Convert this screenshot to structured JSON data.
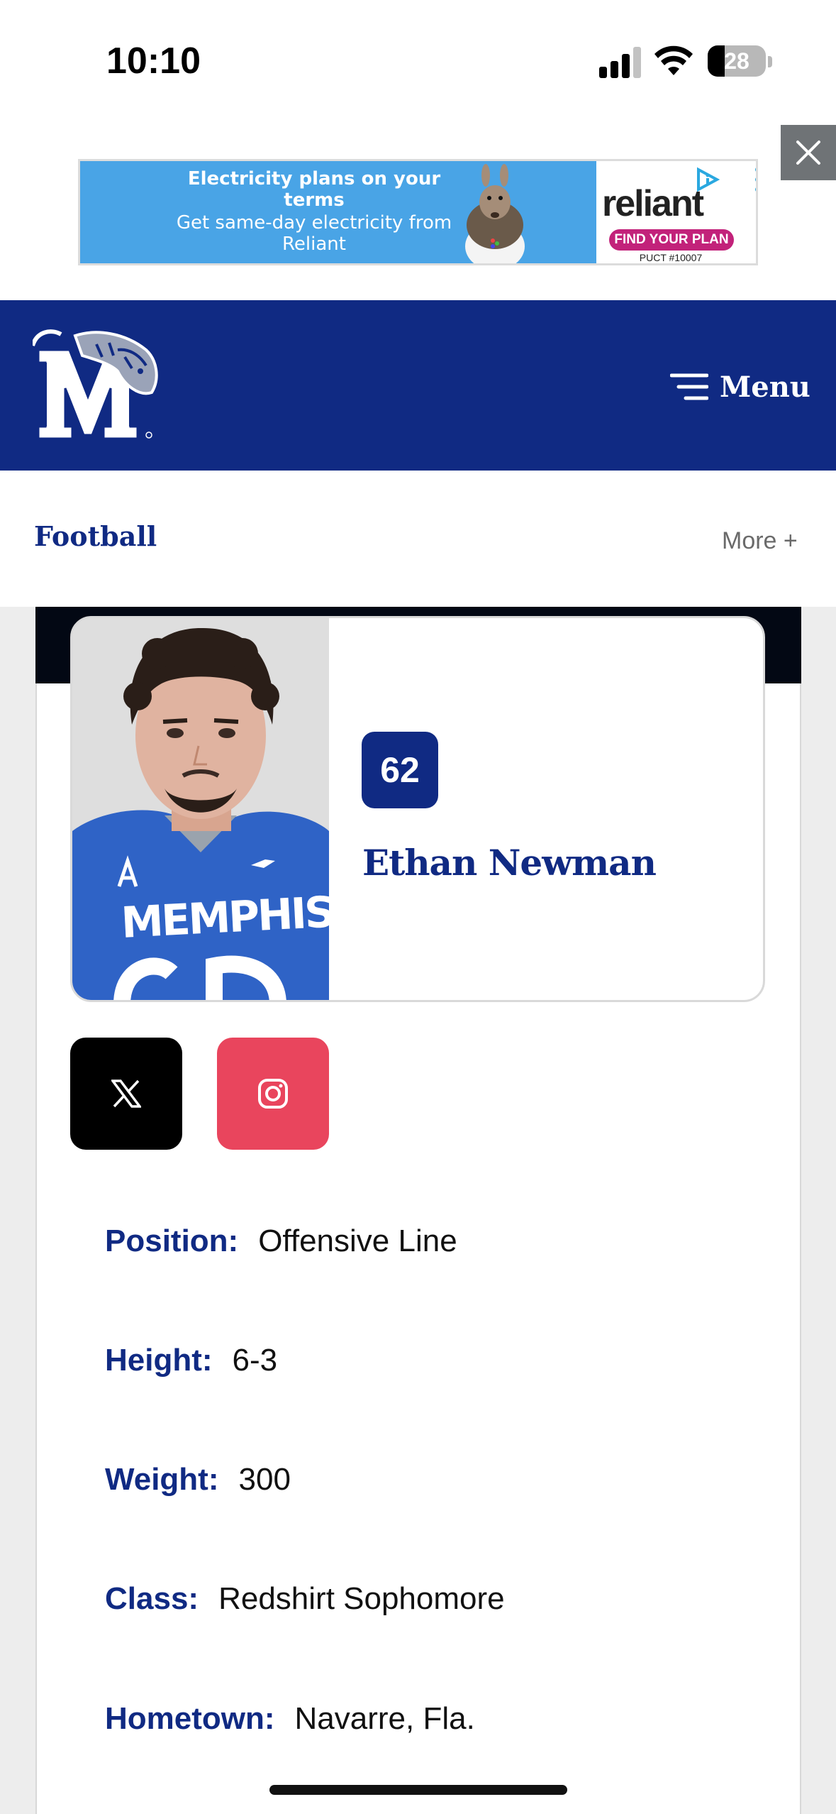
{
  "status_bar": {
    "time": "10:10",
    "battery": "28"
  },
  "ad": {
    "headline": "Electricity plans on your terms",
    "subtext": "Get same-day electricity from Reliant",
    "brand": "reliant",
    "cta": "FIND YOUR PLAN",
    "license": "PUCT #10007"
  },
  "header": {
    "menu_label": "Menu"
  },
  "sub_nav": {
    "sport": "Football",
    "more": "More +"
  },
  "player": {
    "number": "62",
    "name": "Ethan Newman",
    "jersey_text": "MEMPHIS"
  },
  "bio": [
    {
      "label": "Position:",
      "value": "Offensive Line"
    },
    {
      "label": "Height:",
      "value": "6-3"
    },
    {
      "label": "Weight:",
      "value": "300"
    },
    {
      "label": "Class:",
      "value": "Redshirt Sophomore"
    },
    {
      "label": "Hometown:",
      "value": "Navarre, Fla."
    }
  ],
  "colors": {
    "brand_blue": "#102a83",
    "instagram": "#e9455d",
    "ad_blue": "#49a4e6"
  }
}
